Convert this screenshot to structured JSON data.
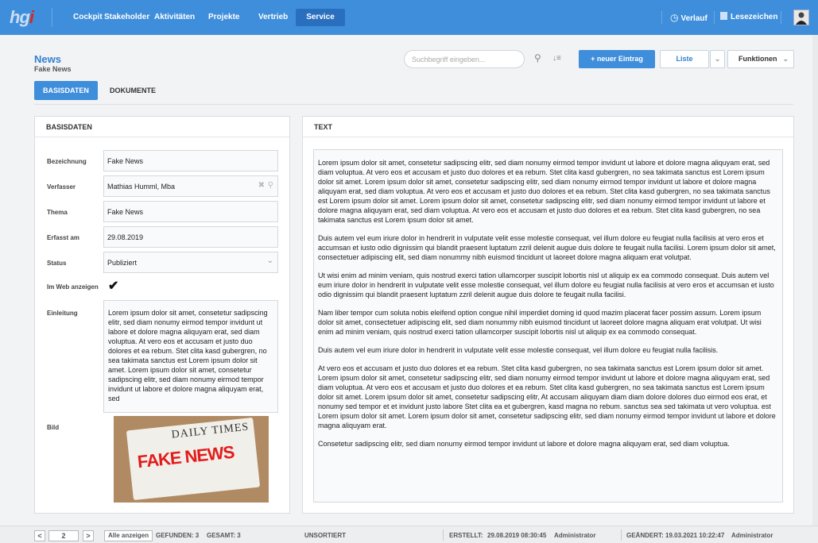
{
  "app": {
    "logo": "hg",
    "logo_i": "i"
  },
  "nav": {
    "items": [
      {
        "label": "Cockpit"
      },
      {
        "label": "Stakeholder"
      },
      {
        "label": "Aktivitäten"
      },
      {
        "label": "Projekte"
      },
      {
        "label": "Vertrieb"
      },
      {
        "label": "Service"
      }
    ],
    "active": "Service",
    "verlauf": "Verlauf",
    "lesezeichen": "Lesezeichen"
  },
  "page": {
    "title": "News",
    "subtitle": "Fake News"
  },
  "toolbar": {
    "search_placeholder": "Suchbegriff eingeben...",
    "new_entry": "+ neuer Eintrag",
    "list": "Liste",
    "functions": "Funktionen"
  },
  "tabs": [
    {
      "label": "BASISDATEN",
      "active": true
    },
    {
      "label": "DOKUMENTE",
      "active": false
    }
  ],
  "basisdaten": {
    "heading": "BASISDATEN",
    "bezeichnung_label": "Bezeichnung",
    "bezeichnung": "Fake News",
    "verfasser_label": "Verfasser",
    "verfasser": "Mathias Humml, Mba",
    "thema_label": "Thema",
    "thema": "Fake News",
    "erfasst_label": "Erfasst am",
    "erfasst": "29.08.2019",
    "status_label": "Status",
    "status": "Publiziert",
    "web_label": "Im Web anzeigen",
    "web_checked": true,
    "einleitung_label": "Einleitung",
    "einleitung": "Lorem ipsum dolor sit amet, consetetur sadipscing elitr, sed diam nonumy eirmod tempor invidunt ut labore et dolore magna aliquyam erat, sed diam voluptua. At vero eos et accusam et justo duo dolores et ea rebum. Stet clita kasd gubergren, no sea takimata sanctus est Lorem ipsum dolor sit amet. Lorem ipsum dolor sit amet, consetetur sadipscing elitr, sed diam nonumy eirmod tempor invidunt ut labore et dolore magna aliquyam erat, sed",
    "bild_label": "Bild",
    "bild_title": "DAILY TIMES",
    "bild_headline": "FAKE NEWS"
  },
  "text_panel": {
    "heading": "TEXT",
    "paragraphs": [
      "Lorem ipsum dolor sit amet, consetetur sadipscing elitr, sed diam nonumy eirmod tempor invidunt ut labore et dolore magna aliquyam erat, sed diam voluptua. At vero eos et accusam et justo duo dolores et ea rebum. Stet clita kasd gubergren, no sea takimata sanctus est Lorem ipsum dolor sit amet. Lorem ipsum dolor sit amet, consetetur sadipscing elitr, sed diam nonumy eirmod tempor invidunt ut labore et dolore magna aliquyam erat, sed diam voluptua. At vero eos et accusam et justo duo dolores et ea rebum. Stet clita kasd gubergren, no sea takimata sanctus est Lorem ipsum dolor sit amet. Lorem ipsum dolor sit amet, consetetur sadipscing elitr, sed diam nonumy eirmod tempor invidunt ut labore et dolore magna aliquyam erat, sed diam voluptua. At vero eos et accusam et justo duo dolores et ea rebum. Stet clita kasd gubergren, no sea takimata sanctus est Lorem ipsum dolor sit amet.",
      "Duis autem vel eum iriure dolor in hendrerit in vulputate velit esse molestie consequat, vel illum dolore eu feugiat nulla facilisis at vero eros et accumsan et iusto odio dignissim qui blandit praesent luptatum zzril delenit augue duis dolore te feugait nulla facilisi. Lorem ipsum dolor sit amet, consectetuer adipiscing elit, sed diam nonummy nibh euismod tincidunt ut laoreet dolore magna aliquam erat volutpat.",
      "Ut wisi enim ad minim veniam, quis nostrud exerci tation ullamcorper suscipit lobortis nisl ut aliquip ex ea commodo consequat. Duis autem vel eum iriure dolor in hendrerit in vulputate velit esse molestie consequat, vel illum dolore eu feugiat nulla facilisis at vero eros et accumsan et iusto odio dignissim qui blandit praesent luptatum zzril delenit augue duis dolore te feugait nulla facilisi.",
      "Nam liber tempor cum soluta nobis eleifend option congue nihil imperdiet doming id quod mazim placerat facer possim assum. Lorem ipsum dolor sit amet, consectetuer adipiscing elit, sed diam nonummy nibh euismod tincidunt ut laoreet dolore magna aliquam erat volutpat. Ut wisi enim ad minim veniam, quis nostrud exerci tation ullamcorper suscipit lobortis nisl ut aliquip ex ea commodo consequat.",
      "Duis autem vel eum iriure dolor in hendrerit in vulputate velit esse molestie consequat, vel illum dolore eu feugiat nulla facilisis.",
      "At vero eos et accusam et justo duo dolores et ea rebum. Stet clita kasd gubergren, no sea takimata sanctus est Lorem ipsum dolor sit amet. Lorem ipsum dolor sit amet, consetetur sadipscing elitr, sed diam nonumy eirmod tempor invidunt ut labore et dolore magna aliquyam erat, sed diam voluptua. At vero eos et accusam et justo duo dolores et ea rebum. Stet clita kasd gubergren, no sea takimata sanctus est Lorem ipsum dolor sit amet. Lorem ipsum dolor sit amet, consetetur sadipscing elitr, At accusam aliquyam diam diam dolore dolores duo eirmod eos erat, et nonumy sed tempor et et invidunt justo labore Stet clita ea et gubergren, kasd magna no rebum. sanctus sea sed takimata ut vero voluptua. est Lorem ipsum dolor sit amet. Lorem ipsum dolor sit amet, consetetur sadipscing elitr, sed diam nonumy eirmod tempor invidunt ut labore et dolore magna aliquyam erat.",
      "Consetetur sadipscing elitr, sed diam nonumy eirmod tempor invidunt ut labore et dolore magna aliquyam erat, sed diam voluptua."
    ]
  },
  "footer": {
    "prev": "<",
    "page": "2",
    "next": ">",
    "show_all": "Alle anzeigen",
    "found": "GEFUNDEN: 3",
    "total": "GESAMT: 3",
    "sort": "UNSORTIERT",
    "created_label": "ERSTELLT:",
    "created": "29.08.2019 08:30:45",
    "created_by": "Administrator",
    "changed_label": "GEÄNDERT:",
    "changed": "19.03.2021 10:22:47",
    "changed_by": "Administrator"
  },
  "colors": {
    "primary": "#3f8edb",
    "active_nav": "#2a6fbe",
    "headline_red": "#e31b1b"
  },
  "icons": [
    "search-icon",
    "sort-icon",
    "chevron-down-icon",
    "clock-icon",
    "bookmark-icon",
    "clear-icon",
    "checkmark-icon"
  ]
}
